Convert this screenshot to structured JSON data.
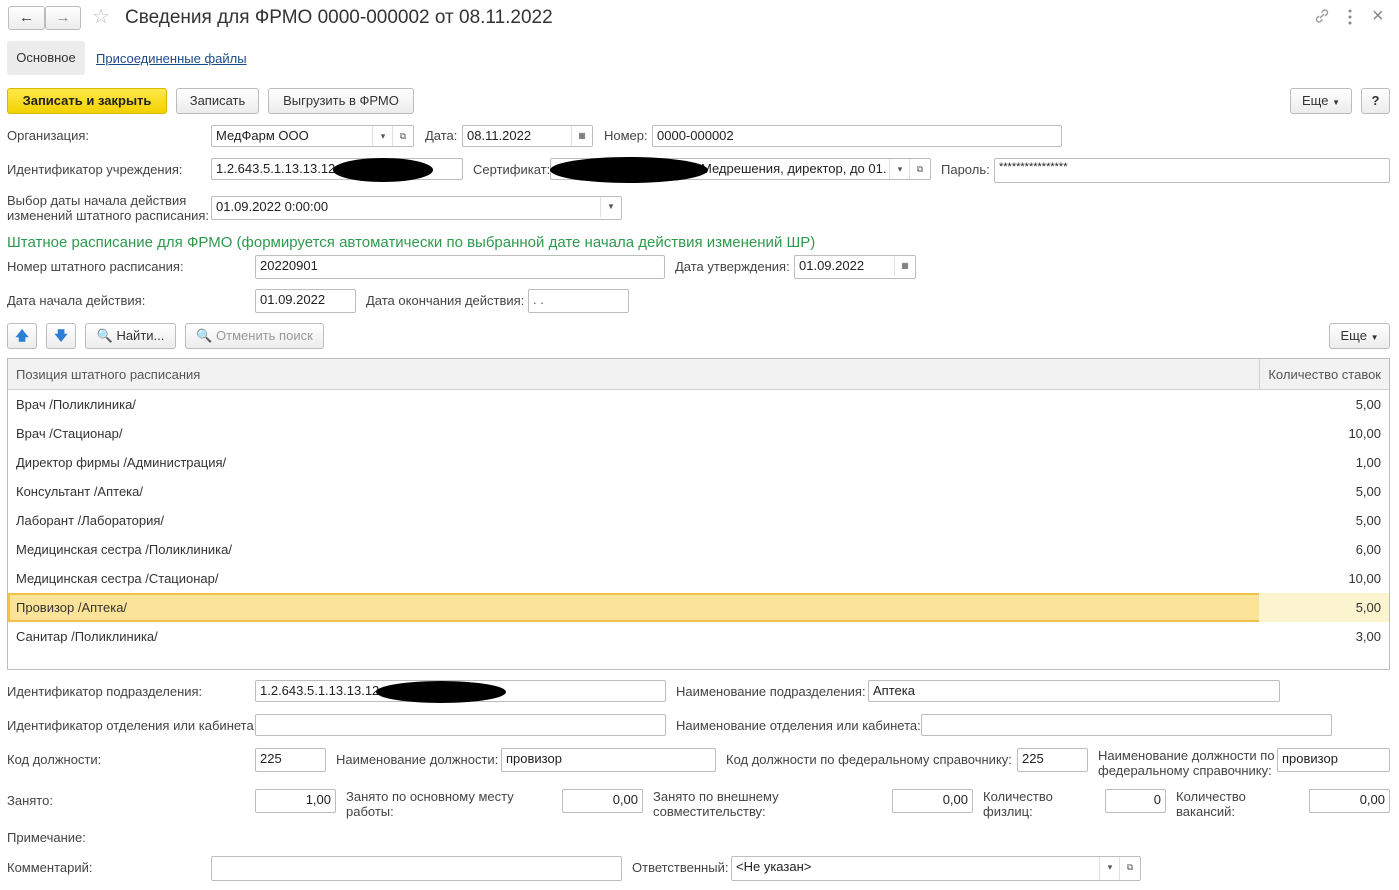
{
  "window": {
    "title": "Сведения для ФРМО 0000-000002 от 08.11.2022"
  },
  "tabs": [
    "Основное",
    "Присоединенные файлы"
  ],
  "toolbar": {
    "save_close": "Записать и закрыть",
    "save": "Записать",
    "export": "Выгрузить в ФРМО",
    "more": "Еще",
    "help": "?"
  },
  "form": {
    "org_label": "Организация:",
    "org_value": "МедФарм ООО",
    "date_label": "Дата:",
    "date_value": "08.11.2022",
    "number_label": "Номер:",
    "number_value": "0000-000002",
    "inst_id_label": "Идентификатор учреждения:",
    "inst_id_value": "1.2.643.5.1.13.13.12",
    "cert_label": "Сертификат:",
    "cert_value": "Медрешения, директор, до 01.",
    "password_label": "Пароль:",
    "password_value": "****************",
    "change_date_label": "Выбор даты начала действия изменений штатного расписания:",
    "change_date_value": "01.09.2022 0:00:00"
  },
  "schedule": {
    "header": "Штатное расписание для ФРМО (формируется автоматически по выбранной дате начала действия изменений ШР)",
    "number_label": "Номер штатного расписания:",
    "number_value": "20220901",
    "approve_label": "Дата утверждения:",
    "approve_value": "01.09.2022",
    "start_label": "Дата начала действия:",
    "start_value": "01.09.2022",
    "end_label": "Дата окончания действия:",
    "end_value": " .  ."
  },
  "table_toolbar": {
    "find": "Найти...",
    "cancel_search": "Отменить поиск",
    "more": "Еще"
  },
  "table": {
    "columns": [
      "Позиция штатного расписания",
      "Количество ставок"
    ],
    "rows": [
      {
        "position": "Врач /Поликлиника/",
        "rates": "5,00"
      },
      {
        "position": "Врач /Стационар/",
        "rates": "10,00"
      },
      {
        "position": "Директор фирмы /Администрация/",
        "rates": "1,00"
      },
      {
        "position": "Консультант /Аптека/",
        "rates": "5,00"
      },
      {
        "position": "Лаборант /Лаборатория/",
        "rates": "5,00"
      },
      {
        "position": "Медицинская сестра /Поликлиника/",
        "rates": "6,00"
      },
      {
        "position": "Медицинская сестра /Стационар/",
        "rates": "10,00"
      },
      {
        "position": "Провизор /Аптека/",
        "rates": "5,00"
      },
      {
        "position": "Санитар /Поликлиника/",
        "rates": "3,00"
      }
    ],
    "selected_index": 7
  },
  "details": {
    "dept_id_label": "Идентификатор подразделения:",
    "dept_id_value": "1.2.643.5.1.13.13.12",
    "dept_name_label": "Наименование подразделения:",
    "dept_name_value": "Аптека",
    "office_id_label": "Идентификатор отделения или кабинета:",
    "office_id_value": "",
    "office_name_label": "Наименование отделения или кабинета:",
    "office_name_value": "",
    "pos_code_label": "Код должности:",
    "pos_code_value": "225",
    "pos_name_label": "Наименование должности:",
    "pos_name_value": "провизор",
    "fed_code_label": "Код должности по федеральному справочнику:",
    "fed_code_value": "225",
    "fed_name_label": "Наименование должности по федеральному справочнику:",
    "fed_name_value": "провизор",
    "occupied_label": "Занято:",
    "occupied_value": "1,00",
    "main_label": "Занято по основному месту работы:",
    "main_value": "0,00",
    "ext_label": "Занято по внешнему совместительству:",
    "ext_value": "0,00",
    "persons_label": "Количество физлиц:",
    "persons_value": "0",
    "vacancies_label": "Количество вакансий:",
    "vacancies_value": "0,00",
    "note_label": "Примечание:",
    "comment_label": "Комментарий:",
    "comment_value": "",
    "responsible_label": "Ответственный:",
    "responsible_value": "<Не указан>"
  }
}
